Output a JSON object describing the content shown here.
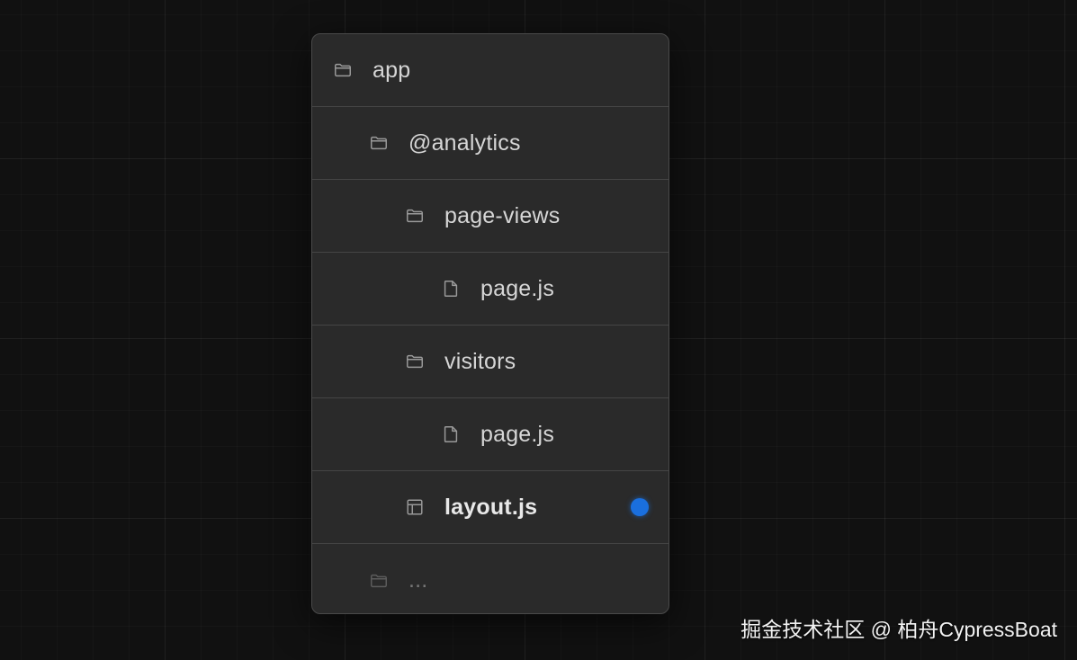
{
  "tree": {
    "rows": [
      {
        "label": "app",
        "icon": "folder-icon",
        "indent": 0,
        "bold": false
      },
      {
        "label": "@analytics",
        "icon": "folder-icon",
        "indent": 1,
        "bold": false
      },
      {
        "label": "page-views",
        "icon": "folder-icon",
        "indent": 2,
        "bold": false
      },
      {
        "label": "page.js",
        "icon": "file-icon",
        "indent": 3,
        "bold": false
      },
      {
        "label": "visitors",
        "icon": "folder-icon",
        "indent": 2,
        "bold": false
      },
      {
        "label": "page.js",
        "icon": "file-icon",
        "indent": 3,
        "bold": false
      },
      {
        "label": "layout.js",
        "icon": "layout-icon",
        "indent": 2,
        "bold": true,
        "status_dot_color": "#1a6fde"
      },
      {
        "label": "...",
        "icon": "folder-icon",
        "indent": 1,
        "bold": false,
        "faded": true
      }
    ]
  },
  "watermark": {
    "text": "掘金技术社区 @ 柏舟CypressBoat"
  },
  "colors": {
    "background": "#111111",
    "panel": "#2a2a2a",
    "divider": "#454545",
    "accent_dot": "#1a6fde",
    "text": "#d6d6d6"
  }
}
